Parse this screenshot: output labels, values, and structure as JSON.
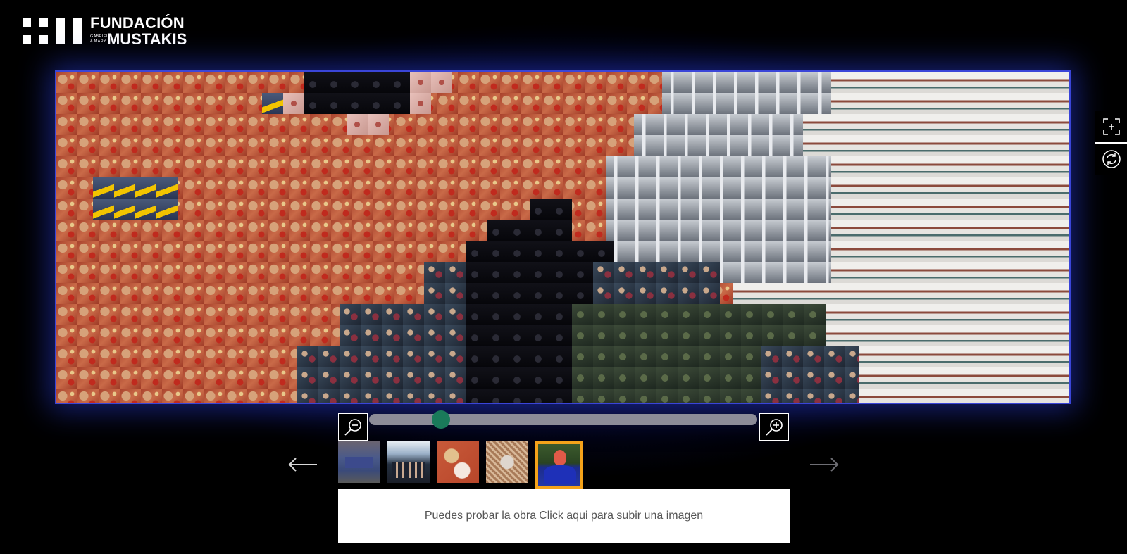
{
  "brand": {
    "name_top": "FUNDACIÓN",
    "name_small": "GABRIEL & MARY",
    "name_bottom": "MUSTAKIS",
    "logo_icon": "fundacion-mustakis-logo"
  },
  "mosaic": {
    "tile_themes": [
      "red-food",
      "dark-night",
      "gray-building",
      "white-room",
      "people",
      "green-garden",
      "yellow-object",
      "pink-cup"
    ],
    "accent_border_color": "#3a45d8"
  },
  "side_tools": [
    {
      "name": "fullscreen",
      "icon": "expand-icon"
    },
    {
      "name": "refresh",
      "icon": "refresh-icon"
    }
  ],
  "zoom": {
    "out_icon": "zoom-out-icon",
    "in_icon": "zoom-in-icon",
    "level": 0.17,
    "thumb_color": "#1a7a5a"
  },
  "carousel": {
    "prev_icon": "arrow-left-icon",
    "next_icon": "arrow-right-icon",
    "thumbnails": [
      {
        "name": "thumb-1",
        "selected": false
      },
      {
        "name": "thumb-2",
        "selected": false
      },
      {
        "name": "thumb-3",
        "selected": false
      },
      {
        "name": "thumb-4",
        "selected": false
      },
      {
        "name": "thumb-5",
        "selected": true
      }
    ],
    "selected_color": "#f5a31a"
  },
  "upload": {
    "prompt": "Puedes probar la obra",
    "link_label": "Click aqui para subir una imagen"
  }
}
